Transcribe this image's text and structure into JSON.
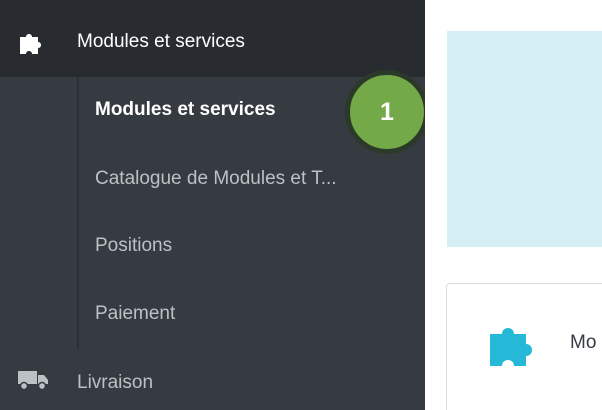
{
  "sidebar": {
    "header": {
      "label": "Modules et services",
      "icon": "puzzle-icon"
    },
    "submenu": [
      {
        "label": "Modules et services",
        "active": true
      },
      {
        "label": "Catalogue de Modules et T...",
        "active": false
      },
      {
        "label": "Positions",
        "active": false
      },
      {
        "label": "Paiement",
        "active": false
      }
    ],
    "next_item": {
      "label": "Livraison",
      "icon": "truck-icon"
    }
  },
  "callout": {
    "number": "1",
    "color": "#74a94a"
  },
  "main": {
    "card": {
      "label": "Mo",
      "icon": "puzzle-icon",
      "icon_color": "#25b9d7"
    }
  },
  "colors": {
    "sidebar_bg": "#363a41",
    "header_bg": "#282b30",
    "info_panel_bg": "#d5f0f5"
  }
}
